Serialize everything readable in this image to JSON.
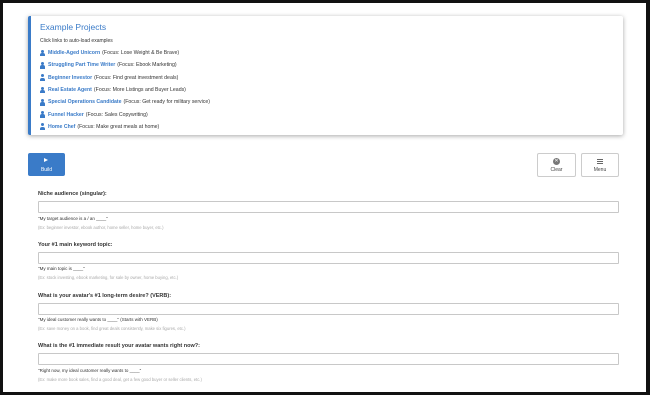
{
  "projects": {
    "title": "Example Projects",
    "hint": "Click links to auto-load examples",
    "items": [
      {
        "name": "Middle-Aged Unicorn",
        "focus": "(Focus: Lose Weight & Be Brave)"
      },
      {
        "name": "Struggling Part Time Writer",
        "focus": "(Focus: Ebook Marketing)"
      },
      {
        "name": "Beginner Investor",
        "focus": "(Focus: Find great investment deals)"
      },
      {
        "name": "Real Estate Agent",
        "focus": "(Focus: More Listings and Buyer Leads)"
      },
      {
        "name": "Special Operations Candidate",
        "focus": "(Focus: Get ready for military service)"
      },
      {
        "name": "Funnel Hacker",
        "focus": "(Focus: Sales Copywriting)"
      },
      {
        "name": "Home Chef",
        "focus": "(Focus: Make great meals at home)"
      }
    ]
  },
  "toolbar": {
    "build_label": "Build",
    "clear_label": "Clear",
    "menu_label": "Menu"
  },
  "fields": [
    {
      "label": "Niche audience (singular):",
      "value": "",
      "hint": "\"My target audience is a / an ____\"",
      "example": "(Ex: beginner investor, ebook author, home seller, home buyer, etc.)"
    },
    {
      "label": "Your #1 main keyword topic:",
      "value": "",
      "hint": "\"My main topic is ____\"",
      "example": "(Ex: stock investing, ebook marketing, for sale by owner, home buying, etc.)"
    },
    {
      "label": "What is your avatar's #1 long-term desire? (VERB):",
      "value": "",
      "hint": "\"My ideal customer really wants to ____\" (Starts with VERB)",
      "example": "(Ex: save money on a book, find great deals consistently, make six figures, etc.)"
    },
    {
      "label": "What is the #1 immediate result your avatar wants right now?:",
      "value": "",
      "hint": "\"Right now, my ideal customer really wants to ____\"",
      "example": "(Ex: make more book sales, find a good deal, get a few good buyer or seller clients, etc.)"
    }
  ]
}
